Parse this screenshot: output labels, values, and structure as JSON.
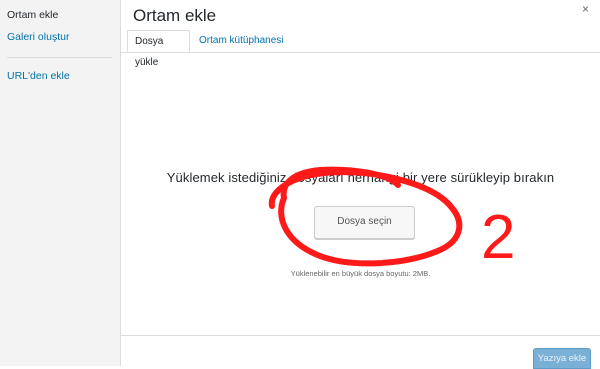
{
  "sidebar": {
    "items": [
      {
        "label": "Ortam ekle"
      },
      {
        "label": "Galeri oluştur"
      },
      {
        "label": "URL'den ekle"
      }
    ]
  },
  "header": {
    "title": "Ortam ekle",
    "close_glyph": "×",
    "tabs": [
      {
        "label": "Dosya yükle"
      },
      {
        "label": "Ortam kütüphanesi"
      }
    ]
  },
  "main": {
    "instructions": "Yüklemek istediğiniz dosyaları herhangi bir yere sürükleyip bırakın",
    "select_button": "Dosya seçin",
    "max_size": "Yüklenebilir en büyük dosya boyutu: 2MB."
  },
  "footer": {
    "insert_button": "Yazıya ekle"
  },
  "annotation": {
    "number": "2",
    "color": "#ff1a1a"
  }
}
